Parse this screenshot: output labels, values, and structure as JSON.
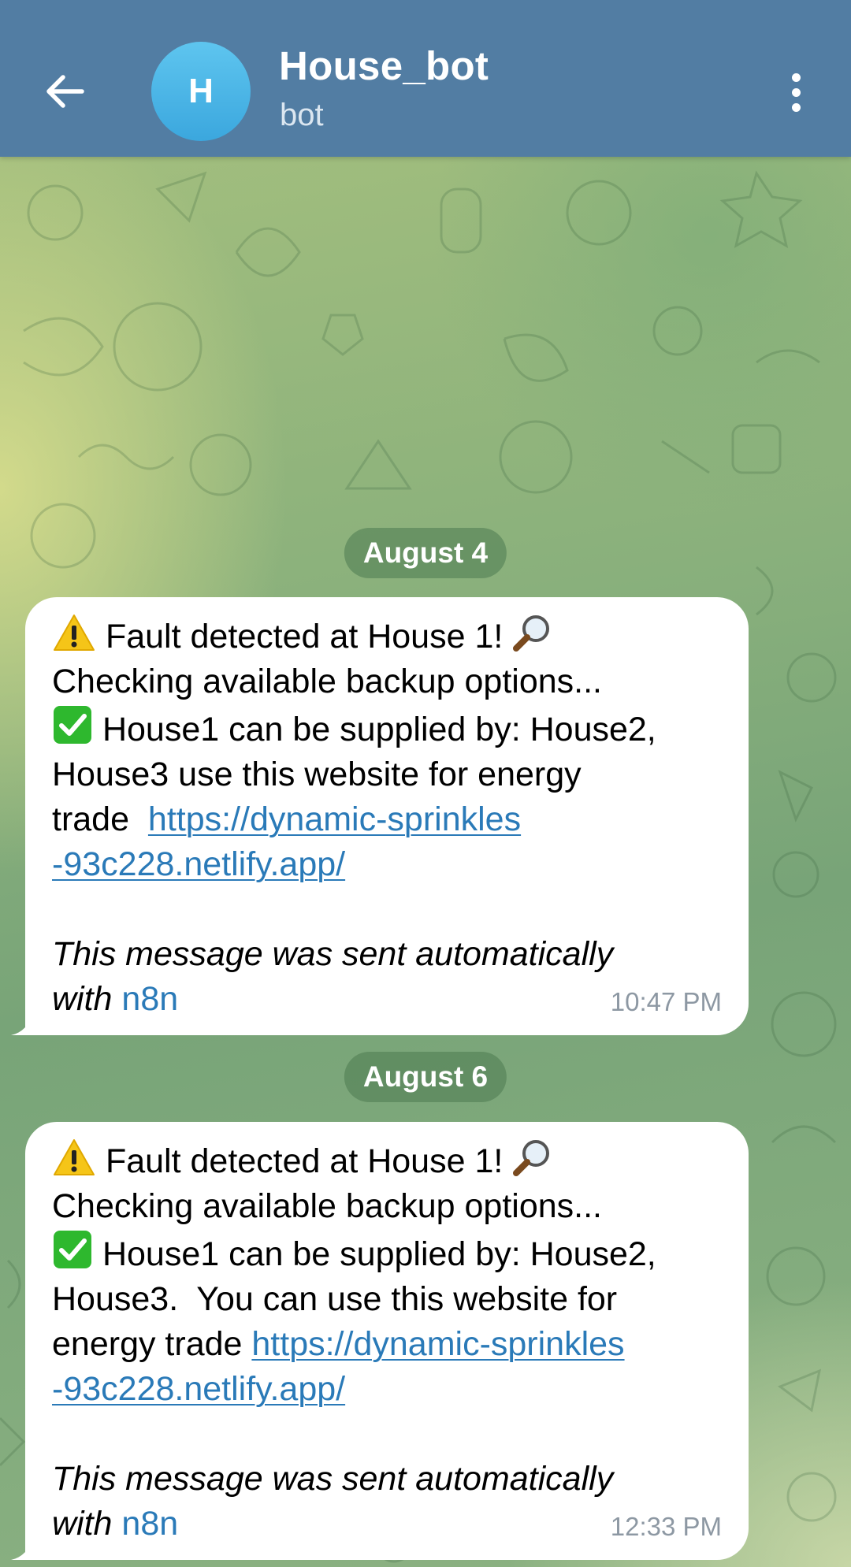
{
  "header": {
    "avatar_letter": "H",
    "title": "House_bot",
    "subtitle": "bot",
    "bar_color": "#527da3"
  },
  "messages": [
    {
      "date": "August 4",
      "line1": "Fault detected at House 1!",
      "line2": "Checking available backup options...",
      "line3": "House1 can be supplied by: House2,",
      "line4": "House3 use this website for energy",
      "line5_text": "trade",
      "line5_link": "https://dynamic-sprinkles",
      "line6_link": "-93c228.netlify.app/",
      "footer_line1": "This message was sent automatically",
      "footer_with": "with",
      "footer_link": "n8n",
      "time": "10:47 PM"
    },
    {
      "date": "August 6",
      "line1": "Fault detected at House 1!",
      "line2": "Checking available backup options...",
      "line3": "House1 can be supplied by: House2,",
      "line4": "House3.  You can use this website for",
      "line5_text": "energy trade",
      "line5_link": "https://dynamic-sprinkles",
      "line6_link": "-93c228.netlify.app/",
      "footer_line1": "This message was sent automatically",
      "footer_with": "with",
      "footer_link": "n8n",
      "time": "12:33 PM"
    }
  ],
  "icons": [
    "back-arrow-icon",
    "more-vertical-icon",
    "warning-icon",
    "magnifier-icon",
    "check-mark-icon"
  ],
  "colors": {
    "link": "#2a7ab8",
    "bubble": "#ffffff",
    "timestamp": "#8d98a3"
  }
}
